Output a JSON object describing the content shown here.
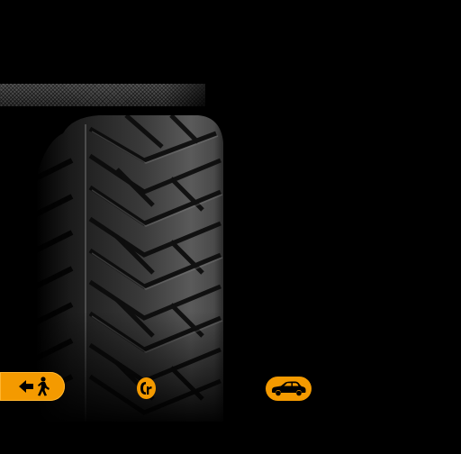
{
  "screen": {
    "background_color": "#000000",
    "accent_color": "#f49a00"
  },
  "banner": {
    "pattern": "checkered",
    "color": "#4a4a4a"
  },
  "tire": {
    "icon": "tire-illustration"
  },
  "buttons": {
    "exit": {
      "icon": "exit-arrow-runner-icon"
    },
    "credits": {
      "icon": "credits-cr-icon"
    },
    "car": {
      "icon": "car-icon"
    }
  }
}
